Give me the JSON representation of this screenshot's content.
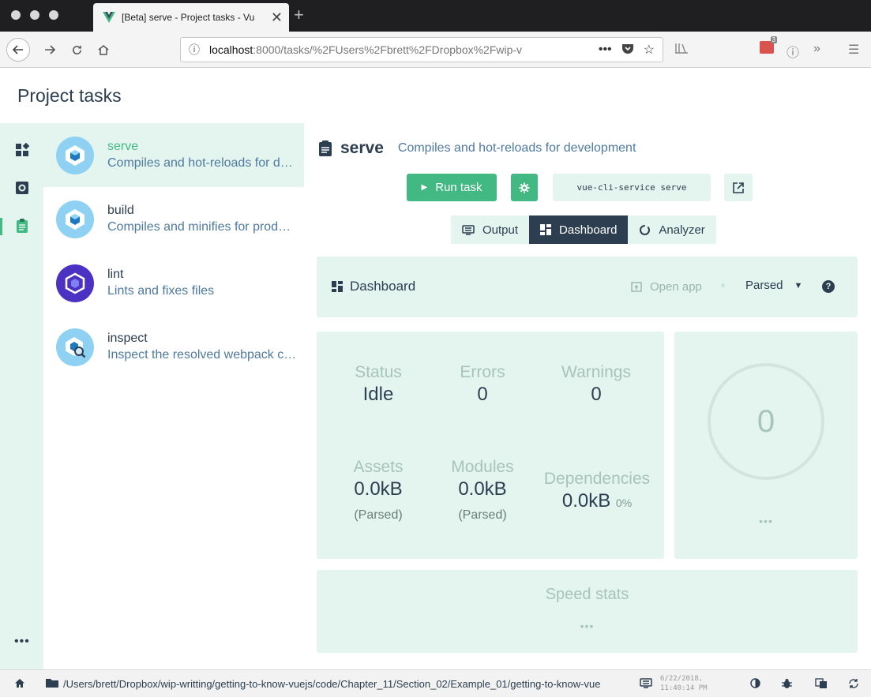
{
  "browser": {
    "tab_title": "[Beta] serve - Project tasks - Vu",
    "url_host": "localhost",
    "url_rest": ":8000/tasks/%2FUsers%2Fbrett%2FDropbox%2Fwip-v",
    "new_tab_label": "+",
    "close_label": "✕",
    "ext_badge": "3"
  },
  "header": {
    "title": "Project tasks"
  },
  "rail": {
    "more_label": "•••"
  },
  "tasks": [
    {
      "name": "serve",
      "description": "Compiles and hot-reloads for development",
      "selected": true,
      "icon": "webpack-cube-icon"
    },
    {
      "name": "build",
      "description": "Compiles and minifies for production",
      "selected": false,
      "icon": "webpack-cube-icon"
    },
    {
      "name": "lint",
      "description": "Lints and fixes files",
      "selected": false,
      "icon": "eslint-hexagon-icon"
    },
    {
      "name": "inspect",
      "description": "Inspect the resolved webpack config",
      "selected": false,
      "icon": "webpack-inspect-icon"
    }
  ],
  "task_detail": {
    "title": "serve",
    "subtitle": "Compiles and hot-reloads for development",
    "run_label": "Run task",
    "command": "vue-cli-service serve",
    "tabs": [
      {
        "label": "Output",
        "active": false
      },
      {
        "label": "Dashboard",
        "active": true
      },
      {
        "label": "Analyzer",
        "active": false
      }
    ]
  },
  "dashboard": {
    "title": "Dashboard",
    "open_app_label": "Open app",
    "mode_label": "Parsed",
    "help_label": "?",
    "stats": {
      "status": {
        "label": "Status",
        "value": "Idle"
      },
      "errors": {
        "label": "Errors",
        "value": "0"
      },
      "warnings": {
        "label": "Warnings",
        "value": "0"
      },
      "assets": {
        "label": "Assets",
        "value": "0.0kB",
        "sub": "(Parsed)"
      },
      "modules": {
        "label": "Modules",
        "value": "0.0kB",
        "sub": "(Parsed)"
      },
      "dependencies": {
        "label": "Dependencies",
        "value": "0.0kB",
        "percent": "0%"
      }
    },
    "ring_value": "0",
    "ring_more": "•••",
    "speed_title": "Speed stats",
    "speed_more": "•••"
  },
  "statusbar": {
    "path": "/Users/brett/Dropbox/wip-writting/getting-to-know-vuejs/code/Chapter_11/Section_02/Example_01/getting-to-know-vue",
    "date": "6/22/2018,",
    "time": "11:40:14 PM"
  },
  "colors": {
    "accent": "#42b983",
    "dark": "#2c3e50",
    "panel": "#e4f5ef",
    "link": "#4f7aa0"
  }
}
